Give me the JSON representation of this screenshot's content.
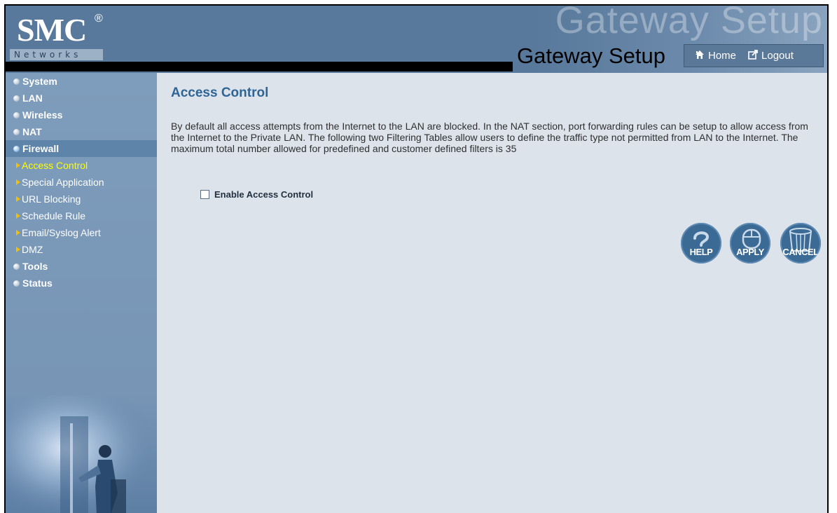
{
  "header": {
    "brand": "SMC",
    "brand_mark": "®",
    "brand_sub": "Networks",
    "watermark": "Gateway Setup",
    "title": "Gateway Setup",
    "home_label": "Home",
    "logout_label": "Logout",
    "home_icon": "home-icon",
    "logout_icon": "logout-icon"
  },
  "sidebar": {
    "items": [
      {
        "label": "System",
        "type": "main"
      },
      {
        "label": "LAN",
        "type": "main"
      },
      {
        "label": "Wireless",
        "type": "main"
      },
      {
        "label": "NAT",
        "type": "main"
      },
      {
        "label": "Firewall",
        "type": "main",
        "active": true
      },
      {
        "label": "Access Control",
        "type": "sub",
        "active": true
      },
      {
        "label": "Special Application",
        "type": "sub"
      },
      {
        "label": "URL Blocking",
        "type": "sub"
      },
      {
        "label": "Schedule Rule",
        "type": "sub"
      },
      {
        "label": "Email/Syslog Alert",
        "type": "sub"
      },
      {
        "label": "DMZ",
        "type": "sub"
      },
      {
        "label": "Tools",
        "type": "main"
      },
      {
        "label": "Status",
        "type": "main"
      }
    ]
  },
  "main": {
    "title": "Access Control",
    "description": "By default all access attempts from the Internet to the LAN are blocked. In the NAT section, port forwarding rules can be setup to allow access from the Internet to the Private LAN. The following two Filtering Tables allow users to define the traffic type not permitted from LAN to the Internet. The maximum total number allowed for predefined and customer defined filters is 35",
    "enable_label": "Enable Access Control",
    "enable_checked": false,
    "buttons": {
      "help": "HELP",
      "apply": "APPLY",
      "cancel": "CANCEL"
    }
  },
  "colors": {
    "header_bg": "#58799b",
    "sidebar_bg": "#7e9cbb",
    "content_bg": "#dde3ea",
    "title_color": "#2f6596",
    "active_sub": "#ffff00",
    "button_bg": "#3b6a95"
  }
}
